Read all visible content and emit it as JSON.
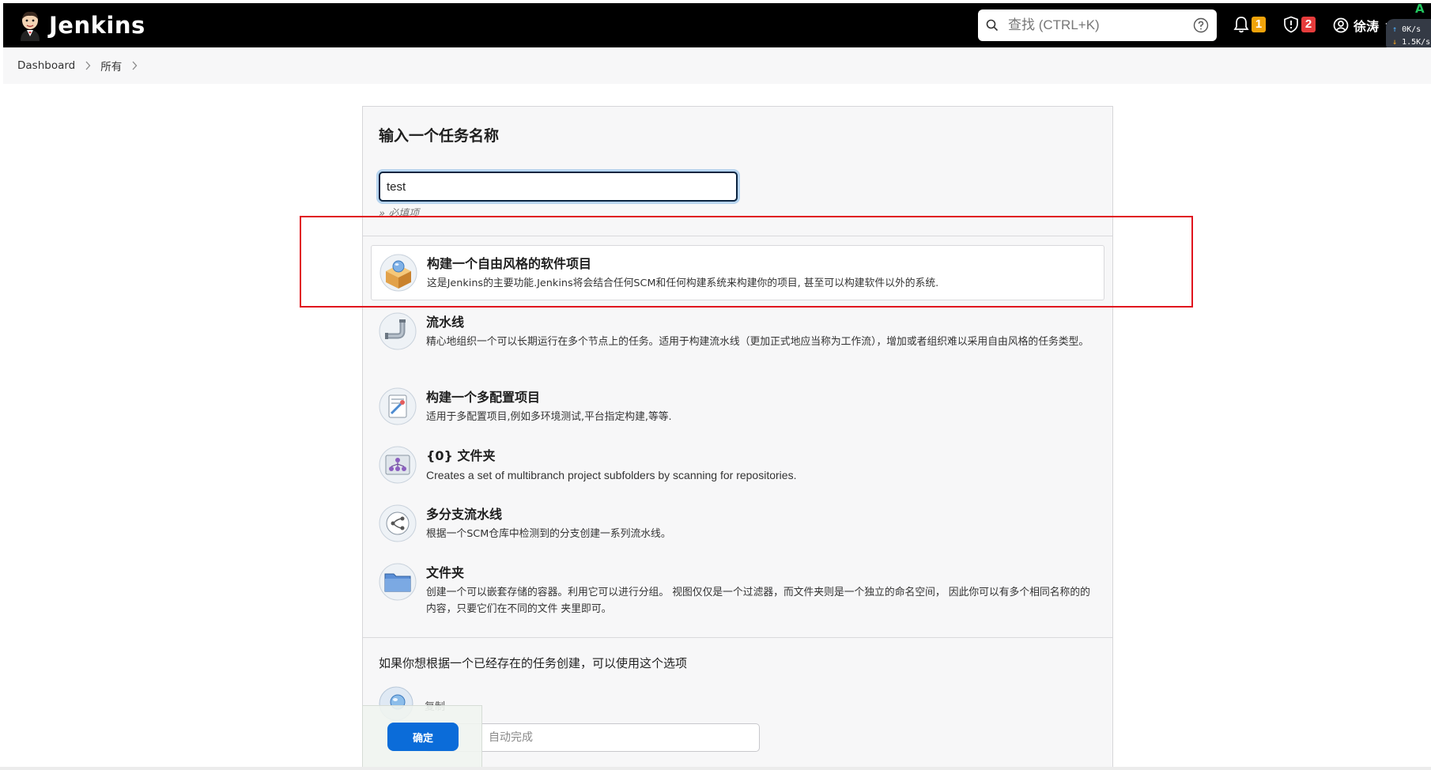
{
  "header": {
    "app_name": "Jenkins",
    "search_placeholder": "查找 (CTRL+K)",
    "notifications_count": "1",
    "security_count": "2",
    "user_name": "徐涛"
  },
  "net_widget": {
    "label": "A",
    "up": "0K/s",
    "down": "1.5K/s"
  },
  "breadcrumb": {
    "items": [
      "Dashboard",
      "所有"
    ]
  },
  "form": {
    "title": "输入一个任务名称",
    "name_value": "test",
    "required_hint": "» 必填项"
  },
  "items": [
    {
      "title": "构建一个自由风格的软件项目",
      "desc": "这是Jenkins的主要功能.Jenkins将会结合任何SCM和任何构建系统来构建你的项目, 甚至可以构建软件以外的系统.",
      "icon": "freestyle-box-icon"
    },
    {
      "title": "流水线",
      "desc": "精心地组织一个可以长期运行在多个节点上的任务。适用于构建流水线（更加正式地应当称为工作流），增加或者组织难以采用自由风格的任务类型。",
      "icon": "pipeline-icon"
    },
    {
      "title": "构建一个多配置项目",
      "desc": "适用于多配置项目,例如多环境测试,平台指定构建,等等.",
      "icon": "multi-config-icon"
    },
    {
      "title": "{0} 文件夹",
      "desc": "Creates a set of multibranch project subfolders by scanning for repositories.",
      "icon": "org-folder-icon"
    },
    {
      "title": "多分支流水线",
      "desc": "根据一个SCM仓库中检测到的分支创建一系列流水线。",
      "icon": "multibranch-icon"
    },
    {
      "title": "文件夹",
      "desc": "创建一个可以嵌套存储的容器。利用它可以进行分组。 视图仅仅是一个过滤器，而文件夹则是一个独立的命名空间， 因此你可以有多个相同名称的的内容，只要它们在不同的文件 夹里即可。",
      "icon": "folder-icon"
    }
  ],
  "copy": {
    "label": "如果你想根据一个已经存在的任务创建，可以使用这个选项",
    "option": "复制",
    "placeholder": "自动完成"
  },
  "ok_button": "确定",
  "colors": {
    "header_bg": "#000000",
    "accent_blue": "#0b6cd9",
    "highlight_red": "#e0141e",
    "badge_orange": "#f0a30a",
    "badge_red": "#e63c3c"
  }
}
